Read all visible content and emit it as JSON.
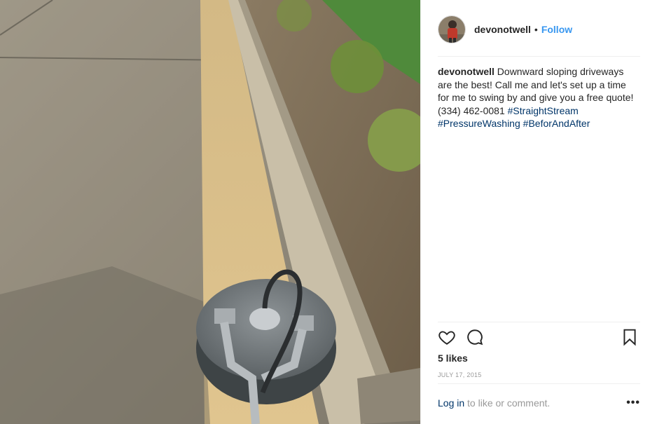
{
  "post": {
    "username": "devonotwell",
    "separator": "•",
    "follow_label": "Follow",
    "caption": {
      "username": "devonotwell",
      "text": "Downward sloping driveways are the best! Call me and let's set up a time for me to swing by and give you a free quote! (334) 462-0081",
      "hashtags": [
        "#StraightStream",
        "#PressureWashing",
        "#BeforAndAfter"
      ]
    },
    "likes": "5 likes",
    "date": "JULY 17, 2015",
    "footer": {
      "login_label": "Log in",
      "suffix": " to like or comment.",
      "more_label": "•••"
    }
  },
  "icons": {
    "like": "heart-icon",
    "comment": "comment-icon",
    "save": "bookmark-icon",
    "more": "more-options-icon"
  },
  "colors": {
    "link": "#3897f0",
    "hashtag": "#003569",
    "muted": "#999999",
    "text": "#262626"
  }
}
